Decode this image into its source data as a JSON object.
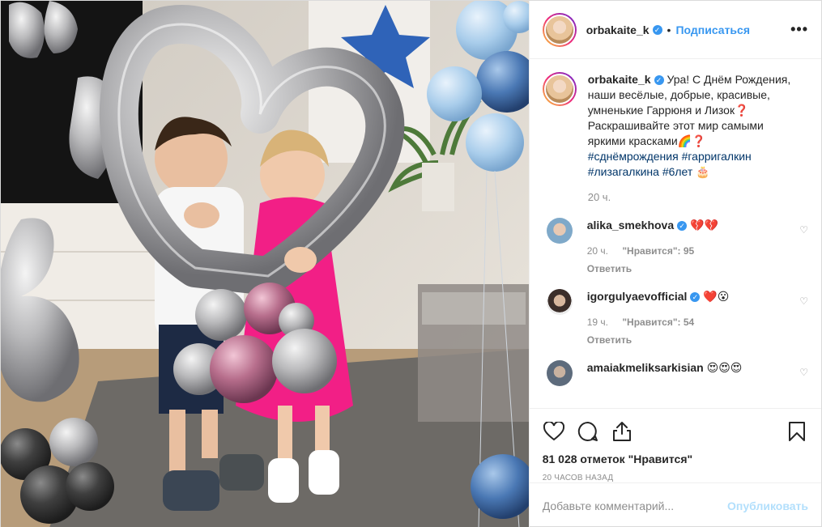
{
  "post": {
    "author": "orbakaite_k",
    "follow_label": "Подписаться",
    "more_label": "•••",
    "dot": "•",
    "caption_text": "Ура! С Днём Рождения, наши весёлые, добрые, красивые, умненькие Гаррюня и Лизок❓ Раскрашивайте этот мир самыми яркими красками🌈❓",
    "hashtags": [
      "#сднёмрождения",
      "#гарригалкин",
      "#лизагалкина",
      "#6лет"
    ],
    "cake_emoji": "🎂",
    "caption_time": "20 ч.",
    "likes_count": "81 028 отметок \"Нравится\"",
    "posted_ago": "20 часов назад",
    "comment_placeholder": "Добавьте комментарий...",
    "publish_label": "Опубликовать"
  },
  "comments": [
    {
      "user": "alika_smekhova",
      "text": "💔💔",
      "time": "20 ч.",
      "likes": "\"Нравится\": 95",
      "reply": "Ответить",
      "verified": true
    },
    {
      "user": "igorgulyaevofficial",
      "text": "❤️😮",
      "time": "19 ч.",
      "likes": "\"Нравится\": 54",
      "reply": "Ответить",
      "verified": true
    },
    {
      "user": "amaiakmeliksarkisian",
      "text": "😍😍😍",
      "verified": false
    }
  ],
  "icons": {
    "like": "heart-icon",
    "comment": "comment-icon",
    "share": "share-icon",
    "save": "bookmark-icon",
    "verified": "verified-icon",
    "more": "more-icon"
  },
  "colors": {
    "link": "#3897f0",
    "hashtag": "#003569",
    "muted": "#8e8e8e",
    "text": "#262626"
  }
}
